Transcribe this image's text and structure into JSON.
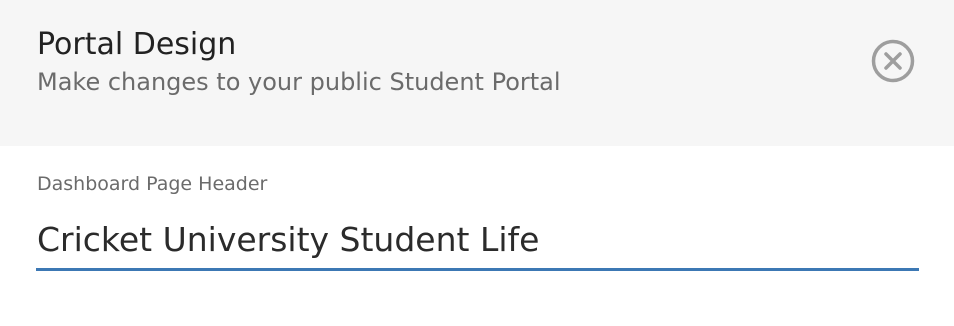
{
  "header": {
    "title": "Portal Design",
    "subtitle": "Make changes to your public Student Portal",
    "close_icon": "close-circle-icon"
  },
  "form": {
    "field_label": "Dashboard Page Header",
    "field_value": "Cricket University Student Life"
  },
  "colors": {
    "header_bg": "#f6f6f6",
    "accent": "#3c78b4",
    "icon": "#9e9e9e"
  }
}
